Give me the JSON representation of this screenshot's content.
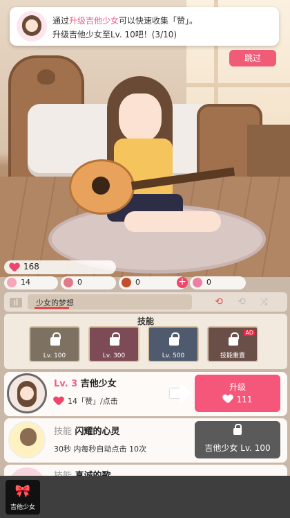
{
  "notification": {
    "line1_prefix": "通过",
    "line1_highlight": "升级吉他少女",
    "line1_suffix": "可以快速收集「赞」。",
    "line2": "升级吉他少女至Lv. 10吧！(3/10)"
  },
  "skip_label": "跳过",
  "stats": {
    "likes": "168",
    "res1": "14",
    "res2": "0",
    "res3": "0",
    "res4": "0",
    "plus": "+"
  },
  "music": {
    "track_name": "少女的梦想",
    "progress": 0.23
  },
  "skills": {
    "header": "技能",
    "items": [
      {
        "label": "Lv. 100"
      },
      {
        "label": "Lv. 300"
      },
      {
        "label": "Lv. 500"
      },
      {
        "label": "技能重置",
        "badge": "AD"
      }
    ]
  },
  "upgrade_card": {
    "level_prefix": "Lv. 3",
    "name": "吉他少女",
    "per_click": "14「赞」/点击",
    "button_title": "升级",
    "button_cost": "111"
  },
  "skill_card": {
    "tag": "技能",
    "title": "闪耀的心灵",
    "desc": "30秒 内每秒自动点击 10次",
    "lock_text": "吉他少女 Lv. 100"
  },
  "skill_card2": {
    "tag": "技能",
    "title": "真诚的歌"
  },
  "nav": {
    "label": "吉他少女"
  },
  "colors": {
    "accent": "#f5577a",
    "highlight": "#ef5d86"
  }
}
